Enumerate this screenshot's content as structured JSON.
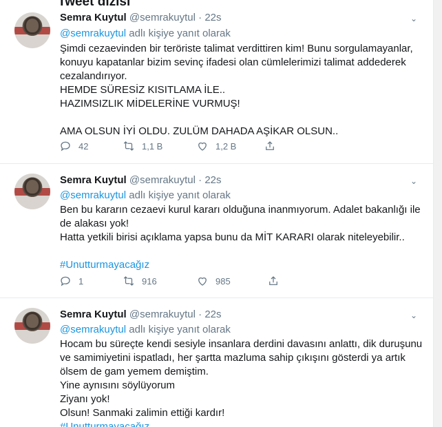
{
  "page": {
    "header_title": "Tweet dizisi"
  },
  "tweets": [
    {
      "name": "Semra Kuytul",
      "handle": "@semrakuytul",
      "time": "22s",
      "reply_mention": "@semrakuytul",
      "reply_suffix": "adlı kişiye yanıt olarak",
      "lines": [
        "Şimdi cezaevinden bir teröriste talimat verdittiren kim! Bunu sorgulamayanlar,",
        "konuyu kapatanlar bizim sevinç ifadesi olan cümlelerimizi talimat addederek",
        "cezalandırıyor.",
        "HEMDE SÜRESİZ KISITLAMA İLE..",
        "HAZIMSIZLIK MİDELERİNE VURMUŞ!",
        "",
        "AMA OLSUN İYİ OLDU. ZULÜM DAHADA AŞİKAR OLSUN.."
      ],
      "hashtag": "",
      "replies": "42",
      "retweets": "1,1 B",
      "likes": "1,2 B"
    },
    {
      "name": "Semra Kuytul",
      "handle": "@semrakuytul",
      "time": "22s",
      "reply_mention": "@semrakuytul",
      "reply_suffix": "adlı kişiye yanıt olarak",
      "lines": [
        "Ben bu kararın cezaevi kurul kararı olduğuna inanmıyorum. Adalet bakanlığı ile",
        "de alakası yok!",
        "Hatta yetkili birisi açıklama yapsa bunu da MİT KARARI olarak niteleyebilir..",
        ""
      ],
      "hashtag": "#Unutturmayacağız",
      "replies": "1",
      "retweets": "916",
      "likes": "985"
    },
    {
      "name": "Semra Kuytul",
      "handle": "@semrakuytul",
      "time": "22s",
      "reply_mention": "@semrakuytul",
      "reply_suffix": "adlı kişiye yanıt olarak",
      "lines": [
        "Hocam bu süreçte kendi sesiyle insanlara derdini davasını anlattı, dik duruşunu",
        "ve samimiyetini ispatladı, her şartta mazluma sahip çıkışını gösterdi ya artık",
        "ölsem de gam yemem demiştim.",
        "Yine aynısını söylüyorum",
        "Ziyanı yok!",
        "Olsun! Sanmaki zalimin ettiği kardır!"
      ],
      "hashtag": "#Unutturmayacağız",
      "replies": "",
      "retweets": "",
      "likes": ""
    }
  ]
}
